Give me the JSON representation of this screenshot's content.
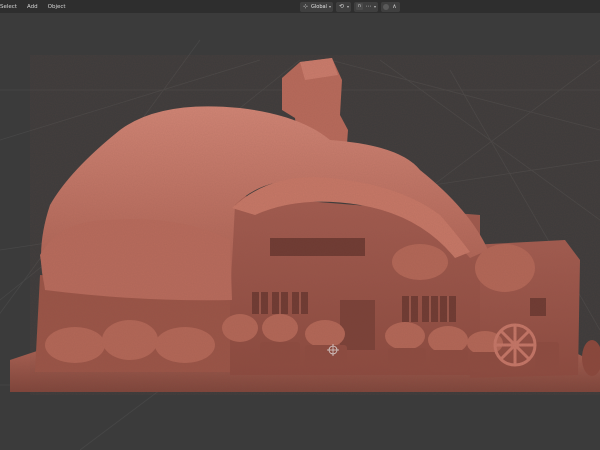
{
  "header": {
    "menu": [
      "Select",
      "Add",
      "Object"
    ],
    "orientation_label": "Global"
  },
  "icons": {
    "orientation": "axis-icon",
    "pivot": "pivot-icon",
    "snap_magnet": "magnet-icon",
    "snap_target": "snap-increment-icon",
    "proportional": "proportional-edit-icon",
    "falloff": "falloff-icon"
  },
  "colors": {
    "viewport_bg": "#3b3b3b",
    "header_bg": "#2e2e2e",
    "grid_line": "#4a4a4a",
    "mesh_base": "#b96a5c",
    "mesh_shadow": "#6e3a32",
    "mesh_highlight": "#d78c7c"
  }
}
